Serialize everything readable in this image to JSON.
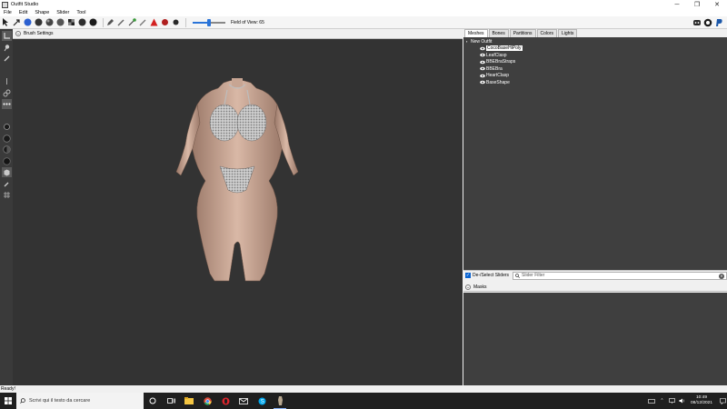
{
  "window": {
    "title": "Outfit Studio"
  },
  "menu": [
    "File",
    "Edit",
    "Shape",
    "Slider",
    "Tool"
  ],
  "toolbar": {
    "fov_label": "Field of View: 65",
    "fov_slider_value": 0.5
  },
  "viewport": {
    "brush_settings_label": "Brush Settings"
  },
  "right_panel": {
    "tabs": [
      "Meshes",
      "Bones",
      "Partitions",
      "Colors",
      "Lights"
    ],
    "tree": {
      "root": "New Outfit",
      "meshes": [
        "CocoBaseHiPoly",
        "LeafClasp",
        "BBEBraStraps",
        "BBEBra",
        "HeartClasp",
        "BaseShape"
      ],
      "selected_index": 0
    },
    "slider_bar": {
      "select_label": "De-/Select Sliders",
      "filter_placeholder": "Slider Filter"
    },
    "masks_label": "Masks"
  },
  "status": {
    "text": "Ready!"
  },
  "taskbar": {
    "search_text": "Scrivi qui il testo da cercare",
    "time": "10:49",
    "date": "08/12/2021",
    "colors": {
      "bg": "#1f1f1f",
      "windows": "#ffffff"
    }
  }
}
